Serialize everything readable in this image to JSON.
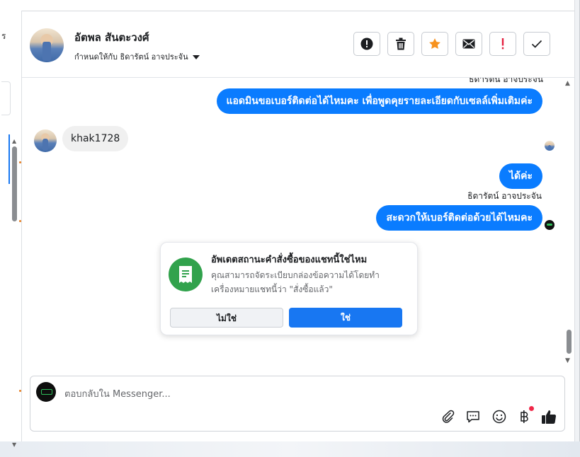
{
  "left_pane": {
    "cut_text": "ร"
  },
  "header": {
    "contact_name": "อัตพล สันตะวงศ์",
    "assign_text": "กำหนดให้กับ ธิดารัตน์ อาจประจัน",
    "actions": [
      {
        "icon": "alert-circle-icon"
      },
      {
        "icon": "trash-icon"
      },
      {
        "icon": "star-icon",
        "color": "#f7921e"
      },
      {
        "icon": "mail-icon"
      },
      {
        "icon": "exclamation-icon",
        "color": "#e41e3f"
      },
      {
        "icon": "check-icon"
      }
    ]
  },
  "messages": {
    "cut_sender": "ธิดารัตน์ อาจประจัน",
    "msg1": "แอดมินขอเบอร์ติดต่อได้ไหมคะ เพื่อพูดคุยรายละเอียดกับเซลล์เพิ่มเติมค่ะ",
    "msg2": "khak1728",
    "msg3": "ได้ค่ะ",
    "sender": "ธิดารัตน์ อาจประจัน",
    "msg4": "สะดวกให้เบอร์ติดต่อด้วยได้ไหมคะ"
  },
  "card": {
    "title": "อัพเดตสถานะคำสั่งซื้อของแชทนี้ใช่ไหม",
    "desc_line1": "คุณสามารถจัดระเบียบกล่องข้อความได้โดยทำ",
    "desc_line2": "เครื่องหมายแชทนี้ว่า \"สั่งซื้อแล้ว\"",
    "no_label": "ไม่ใช่",
    "yes_label": "ใช่",
    "accent": "#1877f2",
    "icon_color": "#31a24c"
  },
  "composer": {
    "placeholder": "ตอบกลับใน Messenger...",
    "icons": [
      "paperclip-icon",
      "chat-bubble-icon",
      "emoji-icon",
      "baht-icon",
      "thumbs-up-icon"
    ]
  },
  "colors": {
    "outgoing_bubble": "#0a7cff",
    "incoming_bubble": "#f0f0f0"
  }
}
